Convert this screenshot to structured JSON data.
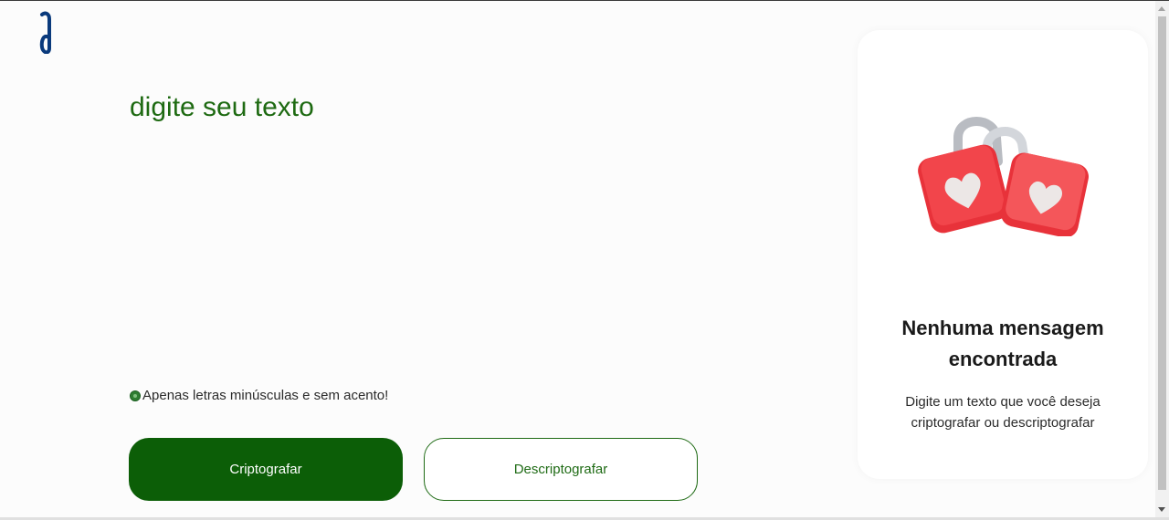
{
  "input": {
    "placeholder": "digite seu texto",
    "value": ""
  },
  "hint": {
    "icon": "info-icon",
    "text": "Apenas letras minúsculas e sem acento!"
  },
  "buttons": {
    "encrypt_label": "Criptografar",
    "decrypt_label": "Descriptografar"
  },
  "output": {
    "illustration": "padlocks-hearts-illustration",
    "title": "Nenhuma mensagem encontrada",
    "description": "Digite um texto que você deseja criptografar ou descriptografar"
  },
  "colors": {
    "primary": "#0c5e07",
    "accent_text": "#1e6a12",
    "lock_red": "#ef3a3f"
  }
}
